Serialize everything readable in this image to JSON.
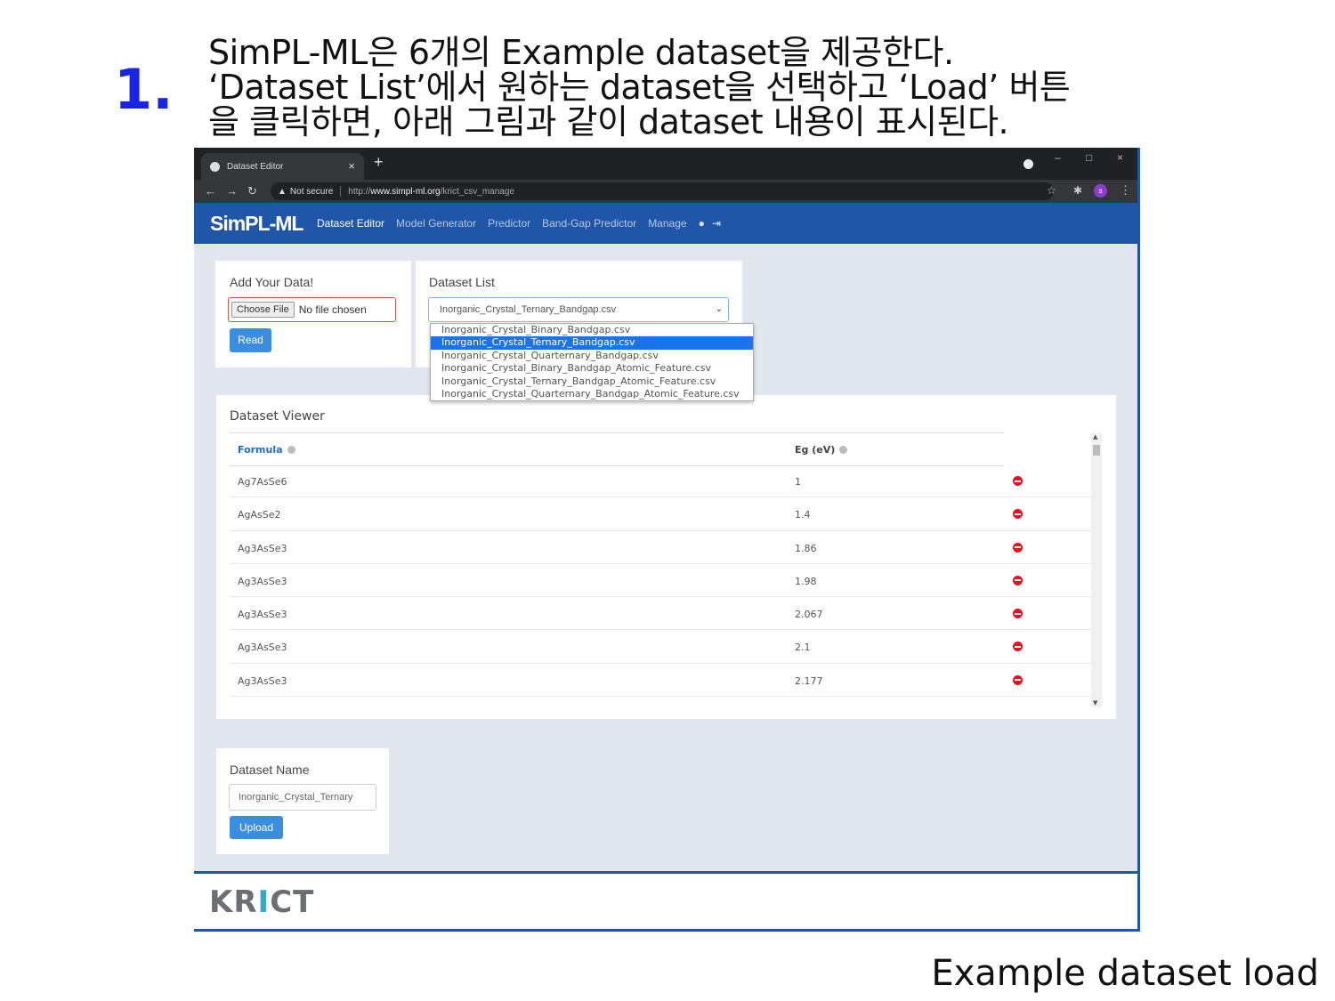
{
  "slide": {
    "step_number": "1.",
    "lines": [
      "SimPL-ML은 6개의 Example dataset을 제공한다.",
      "‘Dataset List’에서 원하는 dataset을 선택하고 ‘Load’ 버튼",
      "을 클릭하면, 아래 그림과 같이 dataset 내용이 표시된다."
    ],
    "caption": "Example dataset load"
  },
  "browser": {
    "tab_title": "Dataset Editor",
    "tab_close": "×",
    "new_tab": "+",
    "security_label": "Not secure",
    "url_prefix": "http://",
    "url_host": "www.simpl-ml.org",
    "url_path": "/krict_csv_manage",
    "avatar_letter": "s",
    "window_min": "–",
    "window_max": "□",
    "window_close": "×"
  },
  "navbar": {
    "logo": "SimPL-ML",
    "links": [
      "Dataset Editor",
      "Model Generator",
      "Predictor",
      "Band-Gap Predictor",
      "Manage"
    ],
    "active_index": 0
  },
  "add_data": {
    "title": "Add Your Data!",
    "choose_file_label": "Choose File",
    "file_status": "No file chosen",
    "read_button": "Read"
  },
  "dataset_list": {
    "title": "Dataset List",
    "selected": "Inorganic_Crystal_Ternary_Bandgap.csv",
    "options": [
      "Inorganic_Crystal_Binary_Bandgap.csv",
      "Inorganic_Crystal_Ternary_Bandgap.csv",
      "Inorganic_Crystal_Quarternary_Bandgap.csv",
      "Inorganic_Crystal_Binary_Bandgap_Atomic_Feature.csv",
      "Inorganic_Crystal_Ternary_Bandgap_Atomic_Feature.csv",
      "Inorganic_Crystal_Quarternary_Bandgap_Atomic_Feature.csv"
    ],
    "highlighted_index": 1
  },
  "viewer": {
    "title": "Dataset Viewer",
    "columns": [
      "Formula",
      "Eg (eV)"
    ],
    "header_color": "#1a6fd1",
    "rows": [
      [
        "Ag7AsSe6",
        "1"
      ],
      [
        "AgAsSe2",
        "1.4"
      ],
      [
        "Ag3AsSe3",
        "1.86"
      ],
      [
        "Ag3AsSe3",
        "1.98"
      ],
      [
        "Ag3AsSe3",
        "2.067"
      ],
      [
        "Ag3AsSe3",
        "2.1"
      ],
      [
        "Ag3AsSe3",
        "2.177"
      ],
      [
        "",
        ""
      ]
    ]
  },
  "dataset_name": {
    "title": "Dataset Name",
    "value": "Inorganic_Crystal_Ternary",
    "upload_button": "Upload"
  },
  "footer": {
    "logo_pre": "KR",
    "logo_i": "I",
    "logo_post": "CT"
  },
  "colors": {
    "navbar": "#1f56a8",
    "accent_button": "#3a8ee0",
    "delete_icon": "#e8101f",
    "step_number": "#1a24e6"
  }
}
